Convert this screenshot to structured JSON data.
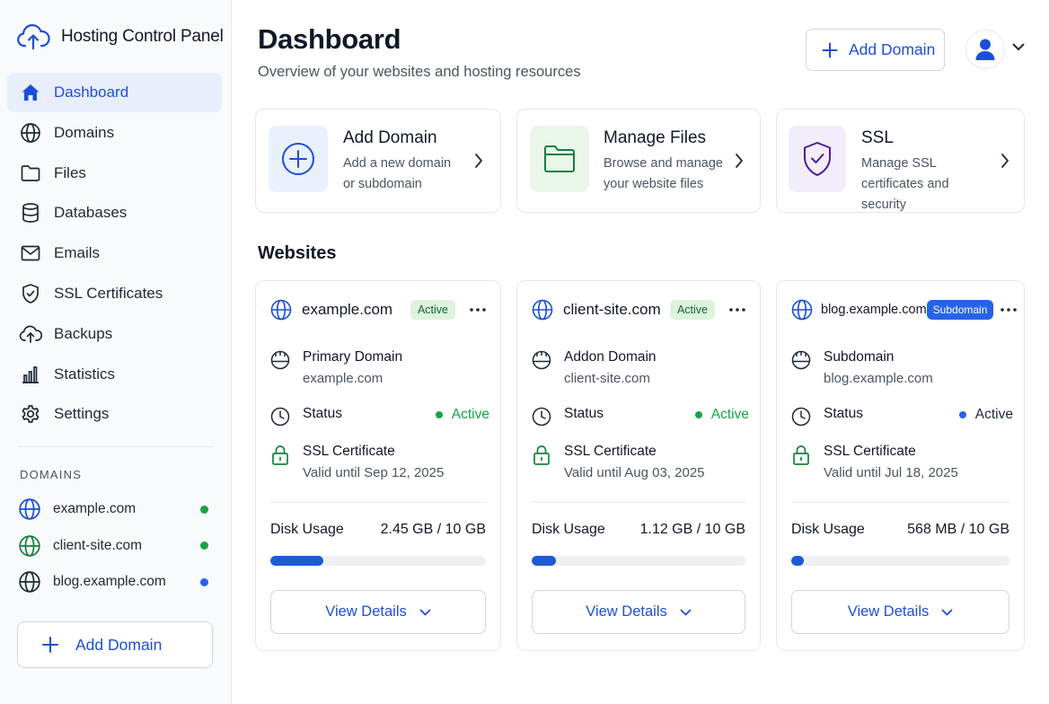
{
  "app": {
    "title": "Hosting Control Panel"
  },
  "colors": {
    "accent": "#1d4ed8",
    "active_green": "#16a34a",
    "subdomain_blue": "#2563eb"
  },
  "sidebar": {
    "nav": [
      {
        "label": "Dashboard",
        "icon": "home-icon",
        "active": true
      },
      {
        "label": "Domains",
        "icon": "globe-icon"
      },
      {
        "label": "Files",
        "icon": "folder-icon"
      },
      {
        "label": "Databases",
        "icon": "database-icon"
      },
      {
        "label": "Emails",
        "icon": "mail-icon"
      },
      {
        "label": "SSL Certificates",
        "icon": "shield-check-icon"
      },
      {
        "label": "Backups",
        "icon": "cloud-upload-icon"
      },
      {
        "label": "Statistics",
        "icon": "bar-chart-icon"
      },
      {
        "label": "Settings",
        "icon": "gear-icon"
      }
    ],
    "domains_heading": "DOMAINS",
    "domains": [
      {
        "name": "example.com",
        "status_color": "#16a34a"
      },
      {
        "name": "client-site.com",
        "status_color": "#16a34a"
      },
      {
        "name": "blog.example.com",
        "status_color": "#2563eb"
      }
    ],
    "add_domain_label": "Add Domain"
  },
  "header": {
    "title": "Dashboard",
    "subtitle": "Overview of your websites and hosting resources",
    "add_domain_label": "Add Domain"
  },
  "quick_actions": [
    {
      "title": "Add Domain",
      "description": "Add a new domain or subdomain",
      "icon": "plus-circle-icon"
    },
    {
      "title": "Manage Files",
      "description": "Browse and manage your website files",
      "icon": "folder-icon"
    },
    {
      "title": "SSL",
      "description": "Manage SSL certificates and security",
      "icon": "shield-check-icon"
    }
  ],
  "websites_heading": "Websites",
  "websites": [
    {
      "domain": "example.com",
      "badge": "Active",
      "type_label": "Primary Domain",
      "type_value": "example.com",
      "status_label": "Status",
      "status_value": "Active",
      "ssl_label": "SSL Certificate",
      "ssl_value": "Valid until Sep 12, 2025",
      "disk_label": "Disk Usage",
      "disk_value": "2.45 GB / 10 GB",
      "disk_fraction": 0.245,
      "details_label": "View Details"
    },
    {
      "domain": "client-site.com",
      "badge": "Active",
      "type_label": "Addon Domain",
      "type_value": "client-site.com",
      "status_label": "Status",
      "status_value": "Active",
      "ssl_label": "SSL Certificate",
      "ssl_value": "Valid until Aug 03, 2025",
      "disk_label": "Disk Usage",
      "disk_value": "1.12 GB / 10 GB",
      "disk_fraction": 0.112,
      "details_label": "View Details"
    },
    {
      "domain": "blog.example.com",
      "badge": "Subdomain",
      "type_label": "Subdomain",
      "type_value": "blog.example.com",
      "status_label": "Status",
      "status_value": "Active",
      "ssl_label": "SSL Certificate",
      "ssl_value": "Valid until Jul 18, 2025",
      "disk_label": "Disk Usage",
      "disk_value": "568 MB / 10 GB",
      "disk_fraction": 0.057,
      "details_label": "View Details"
    }
  ]
}
